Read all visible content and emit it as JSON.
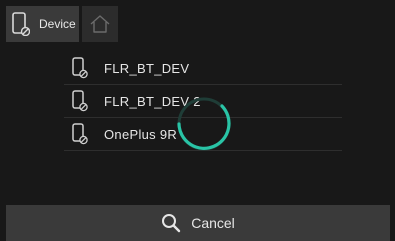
{
  "topbar": {
    "device_tab_label": "Device",
    "home_icon": "home-icon",
    "device_icon": "phone-disconnected-icon"
  },
  "devices": [
    {
      "name": "FLR_BT_DEV",
      "icon": "phone-disconnected-icon"
    },
    {
      "name": "FLR_BT_DEV 2",
      "icon": "phone-disconnected-icon"
    },
    {
      "name": "OnePlus 9R",
      "icon": "phone-disconnected-icon"
    }
  ],
  "spinner": {
    "color": "#29c4a6"
  },
  "footer": {
    "cancel_label": "Cancel",
    "icon": "search-icon"
  },
  "colors": {
    "background": "#181818",
    "bar": "#3a3a3a",
    "accent": "#29c4a6",
    "text": "#e6e6e6"
  }
}
